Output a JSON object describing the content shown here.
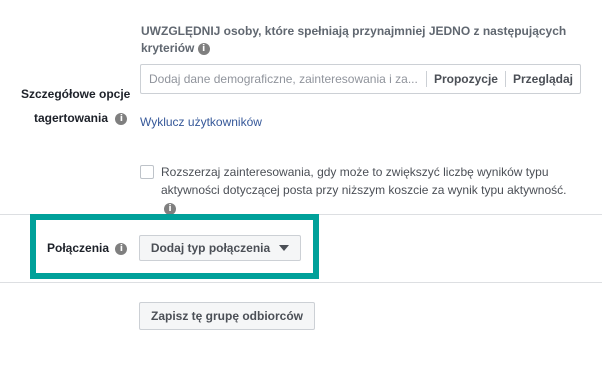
{
  "targeting": {
    "include_heading": "UWZGLĘDNIJ osoby, które spełniają przynajmniej JEDNO z następujących kryteriów",
    "search": {
      "placeholder": "Dodaj dane demograficzne, zainteresowania i za...",
      "value": ""
    },
    "suggestions_label": "Propozycje",
    "browse_label": "Przeglądaj",
    "section_label_line1": "Szczegółowe opcje",
    "section_label_line2": "tagertowania",
    "exclude_link": "Wyklucz użytkowników",
    "expand_interests": {
      "checked": false,
      "text": "Rozszerzaj zainteresowania, gdy może to zwiększyć liczbę wyników typu aktywności dotyczącej posta przy niższym koszcie za wynik typu aktywność."
    }
  },
  "connections": {
    "label": "Połączenia",
    "button_label": "Dodaj typ połączenia",
    "highlight_color": "#00a19a"
  },
  "footer": {
    "save_label": "Zapisz tę grupę odbiorców"
  },
  "icons": {
    "info": "info-icon",
    "dropdown": "caret-down-icon"
  }
}
